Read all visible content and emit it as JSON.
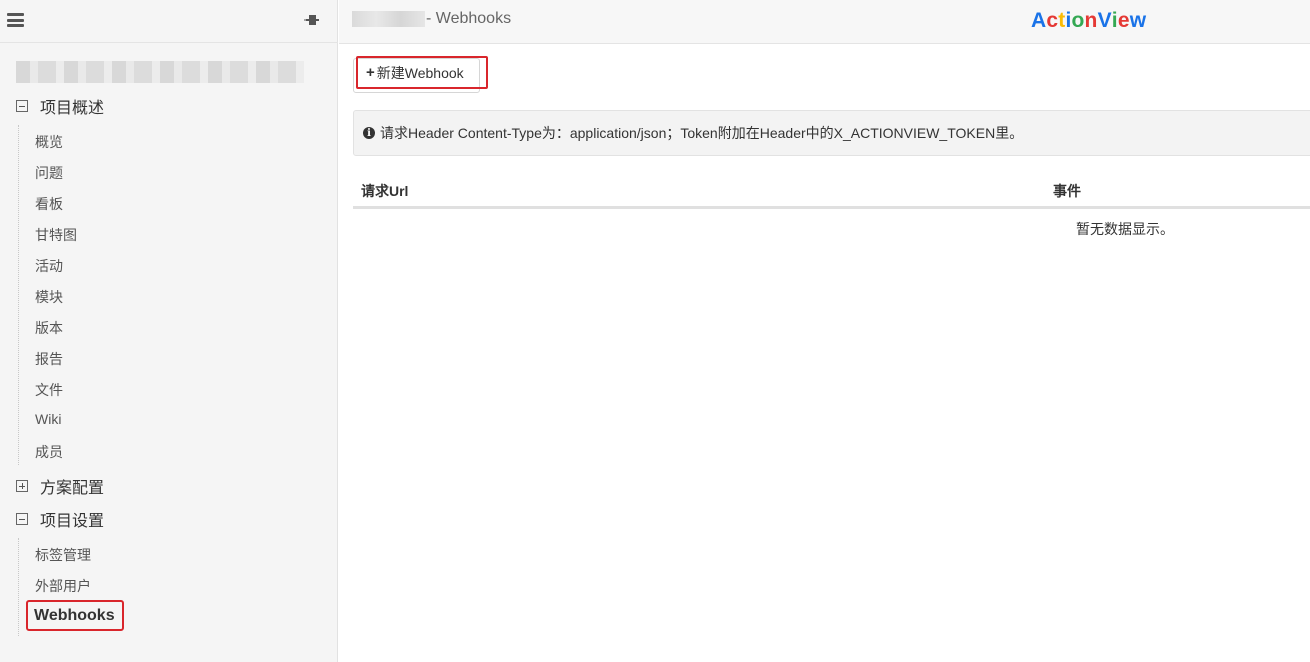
{
  "sidebar": {
    "groups": [
      {
        "label": "项目概述",
        "expanded": true
      },
      {
        "label": "方案配置",
        "expanded": false
      },
      {
        "label": "项目设置",
        "expanded": true
      }
    ],
    "overview_items": [
      "概览",
      "问题",
      "看板",
      "甘特图",
      "活动",
      "模块",
      "版本",
      "报告",
      "文件",
      "Wiki",
      "成员"
    ],
    "settings_items": [
      "标签管理",
      "外部用户"
    ],
    "active_item": "Webhooks"
  },
  "header": {
    "title": "- Webhooks",
    "logo": {
      "letters": [
        "A",
        "c",
        "t",
        "i",
        "o",
        "n",
        "V",
        "i",
        "e",
        "w"
      ],
      "colors": [
        "#1a73e8",
        "#e53935",
        "#fbbc05",
        "#1a73e8",
        "#34a853",
        "#e53935",
        "#1a73e8",
        "#34a853",
        "#e53935",
        "#1a73e8"
      ]
    }
  },
  "main": {
    "new_button": {
      "icon": "plus-icon",
      "label": "新建Webhook"
    },
    "info": {
      "icon": "info-icon",
      "text": "请求Header Content-Type为：application/json；Token附加在Header中的X_ACTIONVIEW_TOKEN里。"
    },
    "table": {
      "columns": [
        "请求Url",
        "事件"
      ],
      "empty_text": "暂无数据显示。"
    }
  },
  "colors": {
    "highlight": "#d9262c"
  }
}
